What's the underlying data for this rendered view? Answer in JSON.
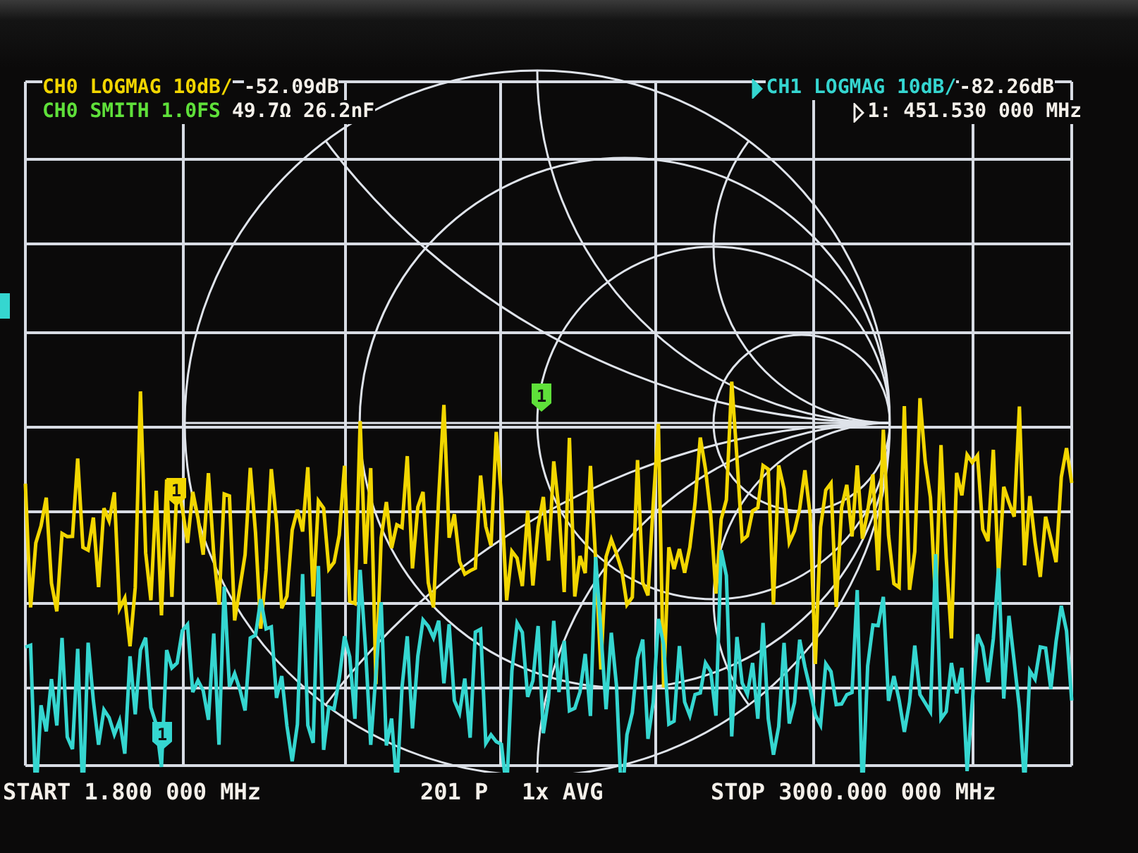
{
  "channels_left": [
    {
      "label": "CH0 LOGMAG 10dB/",
      "reading": "-52.09dB",
      "color": "#f2d600",
      "active": false
    },
    {
      "label": "CH0 SMITH 1.0FS",
      "reading": "49.7Ω 26.2nF",
      "color": "#5fe03a",
      "active": false
    }
  ],
  "channels_right": [
    {
      "label": "CH1 LOGMAG 10dB/",
      "reading": "-82.26dB",
      "color": "#35d6d0",
      "active": true
    }
  ],
  "marker_readout": "1: 451.530 000 MHz",
  "markers": [
    {
      "label": "1",
      "color": "#f2d600"
    },
    {
      "label": "1",
      "color": "#5fe03a"
    },
    {
      "label": "1",
      "color": "#35d6d0"
    }
  ],
  "footer": {
    "start": "START 1.800 000 MHz",
    "points": "201 P",
    "averaging": "1x AVG",
    "stop": "STOP 3000.000 000 MHz"
  }
}
